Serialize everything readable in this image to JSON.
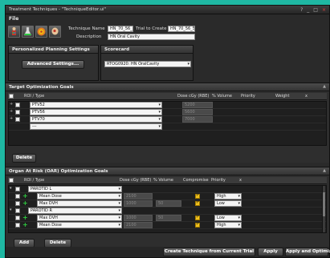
{
  "window": {
    "title": "Treatment Techniques - \"TechniqueEditor.ui\"",
    "controls": [
      "?",
      "_",
      "□",
      "×"
    ]
  },
  "menu": {
    "file": "File"
  },
  "technique": {
    "name_label": "Technique Name",
    "name_value": "HN_70_56_50",
    "trial_label": "Trial to Create",
    "trial_value": "HN_70_56_52",
    "description_label": "Description",
    "description_value": "HN Oral Cavity"
  },
  "personalized": {
    "header": "Personalized Planning Settings",
    "button": "Advanced Settings..."
  },
  "scorecard": {
    "header": "Scorecard",
    "value": "RTOG0920: HN OralCavity"
  },
  "target_goals": {
    "header": "Target Optimization Goals",
    "columns": [
      "ROI / Type",
      "Dose cGy (RBE)",
      "% Volume",
      "Priority",
      "Weight"
    ],
    "rows": [
      {
        "roi": "PTV52",
        "dose": "5200"
      },
      {
        "roi": "PTV56",
        "dose": "5600"
      },
      {
        "roi": "PTV70",
        "dose": "7000"
      },
      {
        "roi": "---",
        "dose": ""
      }
    ],
    "delete_button": "Delete"
  },
  "oar_goals": {
    "header": "Organ At Risk (OAR) Optimization Goals",
    "columns": [
      "ROI / Type",
      "Dose cGy (RBE)",
      "% Volume",
      "Compromise",
      "Priority"
    ],
    "rows": [
      {
        "kind": "roi",
        "name": "PAROTID L"
      },
      {
        "kind": "goal",
        "type": "Mean Dose",
        "dose": "2100",
        "volume": "",
        "compromise": true,
        "priority": "High"
      },
      {
        "kind": "goal",
        "type": "Max DVH",
        "dose": "1000",
        "volume": "50",
        "compromise": true,
        "priority": "Low"
      },
      {
        "kind": "roi",
        "name": "PAROTID R"
      },
      {
        "kind": "goal",
        "type": "Max DVH",
        "dose": "1000",
        "volume": "50",
        "compromise": true,
        "priority": "Low"
      },
      {
        "kind": "goal",
        "type": "Mean Dose",
        "dose": "2100",
        "volume": "",
        "compromise": true,
        "priority": "High"
      }
    ],
    "add_button": "Add",
    "delete_button": "Delete"
  },
  "footer": {
    "create_button": "Create Technique from Current Trial",
    "apply_button": "Apply",
    "apply_optimize_button": "Apply and Optimize"
  },
  "icons": {
    "tool1": "patient-organs-icon",
    "tool2": "flask-icon",
    "tool3": "target-icon",
    "tool4": "head-profile-icon"
  }
}
